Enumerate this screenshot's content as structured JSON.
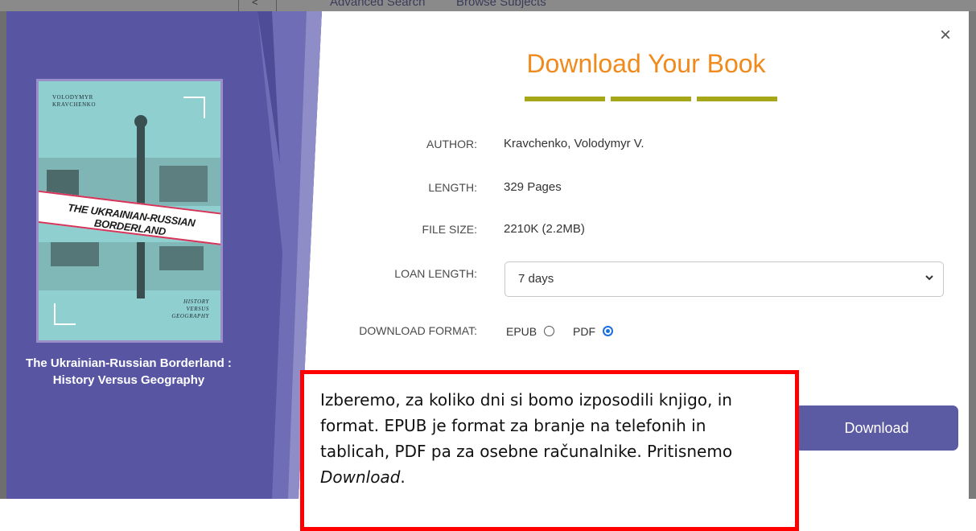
{
  "background_page": {
    "nav_links": [
      "Advanced Search",
      "Browse Subjects"
    ]
  },
  "modal": {
    "title": "Download Your Book",
    "close_label": "×",
    "book": {
      "cover": {
        "author_line": "VOLODYMYR\nKRAVCHENKO",
        "title_line": "THE UKRAINIAN-RUSSIAN BORDERLAND",
        "subtitle_line": "HISTORY\nVERSUS\nGEOGRAPHY"
      },
      "title": "The Ukrainian-Russian Borderland : History Versus Geography"
    },
    "details": {
      "author": {
        "label": "AUTHOR:",
        "value": "Kravchenko, Volodymyr V."
      },
      "length": {
        "label": "LENGTH:",
        "value": "329 Pages"
      },
      "file_size": {
        "label": "FILE SIZE:",
        "value": "2210K (2.2MB)"
      },
      "loan_length": {
        "label": "LOAN LENGTH:",
        "selected": "7 days"
      },
      "download_format": {
        "label": "DOWNLOAD FORMAT:",
        "options": [
          {
            "label": "EPUB",
            "checked": false
          },
          {
            "label": "PDF",
            "checked": true
          }
        ]
      }
    },
    "download_button": "Download"
  },
  "annotation": {
    "text_before": "Izberemo, za koliko dni si bomo izposodili knjigo, in format. EPUB je format za branje na telefonih in tablicah, PDF pa za osebne računalnike. Pritisnemo ",
    "text_emphasis": "Download",
    "text_after": "."
  },
  "colors": {
    "side_panel": "#5856a3",
    "title_orange": "#f08a1c",
    "title_bars": "#a6a619",
    "button": "#5a5ba3",
    "radio_selected": "#1a6fe0",
    "annotation_border": "#ff0000"
  },
  "icons": {
    "close": "close-icon",
    "select_arrow": "chevron-down-icon"
  }
}
